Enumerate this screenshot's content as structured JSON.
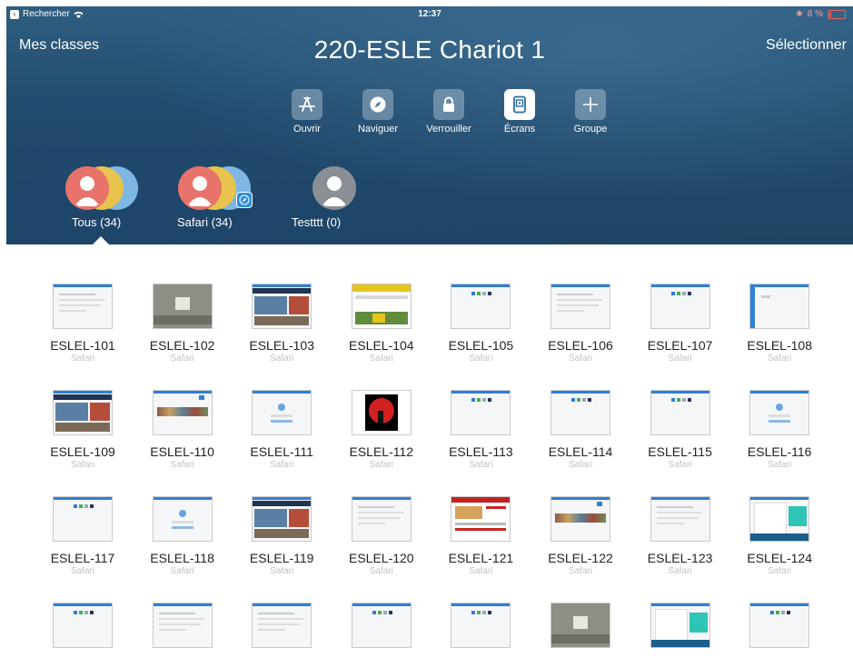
{
  "status": {
    "left_label": "Rechercher",
    "time": "12:37",
    "battery": "8 %"
  },
  "nav": {
    "left": "Mes classes",
    "title": "220-ESLE Chariot 1",
    "right": "Sélectionner"
  },
  "toolbar": [
    {
      "label": "Ouvrir",
      "icon": "app-store-icon"
    },
    {
      "label": "Naviguer",
      "icon": "compass-icon"
    },
    {
      "label": "Verrouiller",
      "icon": "lock-icon"
    },
    {
      "label": "Écrans",
      "icon": "screen-icon",
      "active": true
    },
    {
      "label": "Groupe",
      "icon": "plus-icon"
    }
  ],
  "groups": [
    {
      "label": "Tous (34)",
      "selected": true
    },
    {
      "label": "Safari (34)"
    },
    {
      "label": "Testttt (0)"
    }
  ],
  "devices": [
    {
      "name": "ESLEL-101",
      "app": "Safari",
      "thumb": "white-page"
    },
    {
      "name": "ESLEL-102",
      "app": "Safari",
      "thumb": "gray-photo"
    },
    {
      "name": "ESLEL-103",
      "app": "Safari",
      "thumb": "news-site"
    },
    {
      "name": "ESLEL-104",
      "app": "Safari",
      "thumb": "yellow-site"
    },
    {
      "name": "ESLEL-105",
      "app": "Safari",
      "thumb": "blank-dots"
    },
    {
      "name": "ESLEL-106",
      "app": "Safari",
      "thumb": "white-page"
    },
    {
      "name": "ESLEL-107",
      "app": "Safari",
      "thumb": "blank-dots"
    },
    {
      "name": "ESLEL-108",
      "app": "Safari",
      "thumb": "blue-side"
    },
    {
      "name": "ESLEL-109",
      "app": "Safari",
      "thumb": "news-site"
    },
    {
      "name": "ESLEL-110",
      "app": "Safari",
      "thumb": "photo-strip"
    },
    {
      "name": "ESLEL-111",
      "app": "Safari",
      "thumb": "login"
    },
    {
      "name": "ESLEL-112",
      "app": "Safari",
      "thumb": "red-circle"
    },
    {
      "name": "ESLEL-113",
      "app": "Safari",
      "thumb": "blank-dots"
    },
    {
      "name": "ESLEL-114",
      "app": "Safari",
      "thumb": "blank-dots"
    },
    {
      "name": "ESLEL-115",
      "app": "Safari",
      "thumb": "blank-dots"
    },
    {
      "name": "ESLEL-116",
      "app": "Safari",
      "thumb": "login"
    },
    {
      "name": "ESLEL-117",
      "app": "Safari",
      "thumb": "blank-dots"
    },
    {
      "name": "ESLEL-118",
      "app": "Safari",
      "thumb": "login"
    },
    {
      "name": "ESLEL-119",
      "app": "Safari",
      "thumb": "news-site"
    },
    {
      "name": "ESLEL-120",
      "app": "Safari",
      "thumb": "white-page"
    },
    {
      "name": "ESLEL-121",
      "app": "Safari",
      "thumb": "red-site"
    },
    {
      "name": "ESLEL-122",
      "app": "Safari",
      "thumb": "photo-strip"
    },
    {
      "name": "ESLEL-123",
      "app": "Safari",
      "thumb": "white-page"
    },
    {
      "name": "ESLEL-124",
      "app": "Safari",
      "thumb": "teal-site"
    },
    {
      "name": "",
      "app": "",
      "thumb": "blank-dots"
    },
    {
      "name": "",
      "app": "",
      "thumb": "white-page"
    },
    {
      "name": "",
      "app": "",
      "thumb": "white-page"
    },
    {
      "name": "",
      "app": "",
      "thumb": "blank-dots"
    },
    {
      "name": "",
      "app": "",
      "thumb": "blank-dots"
    },
    {
      "name": "",
      "app": "",
      "thumb": "gray-photo"
    },
    {
      "name": "",
      "app": "",
      "thumb": "teal-site"
    },
    {
      "name": "",
      "app": "",
      "thumb": "blank-dots"
    }
  ],
  "colors": {
    "header": "#234d6d",
    "accent": "#2f8fe0",
    "avatar_red": "#e8736a",
    "avatar_yellow": "#e8c34d",
    "avatar_blue": "#7fb7e4",
    "avatar_gray": "#8a8f96"
  }
}
